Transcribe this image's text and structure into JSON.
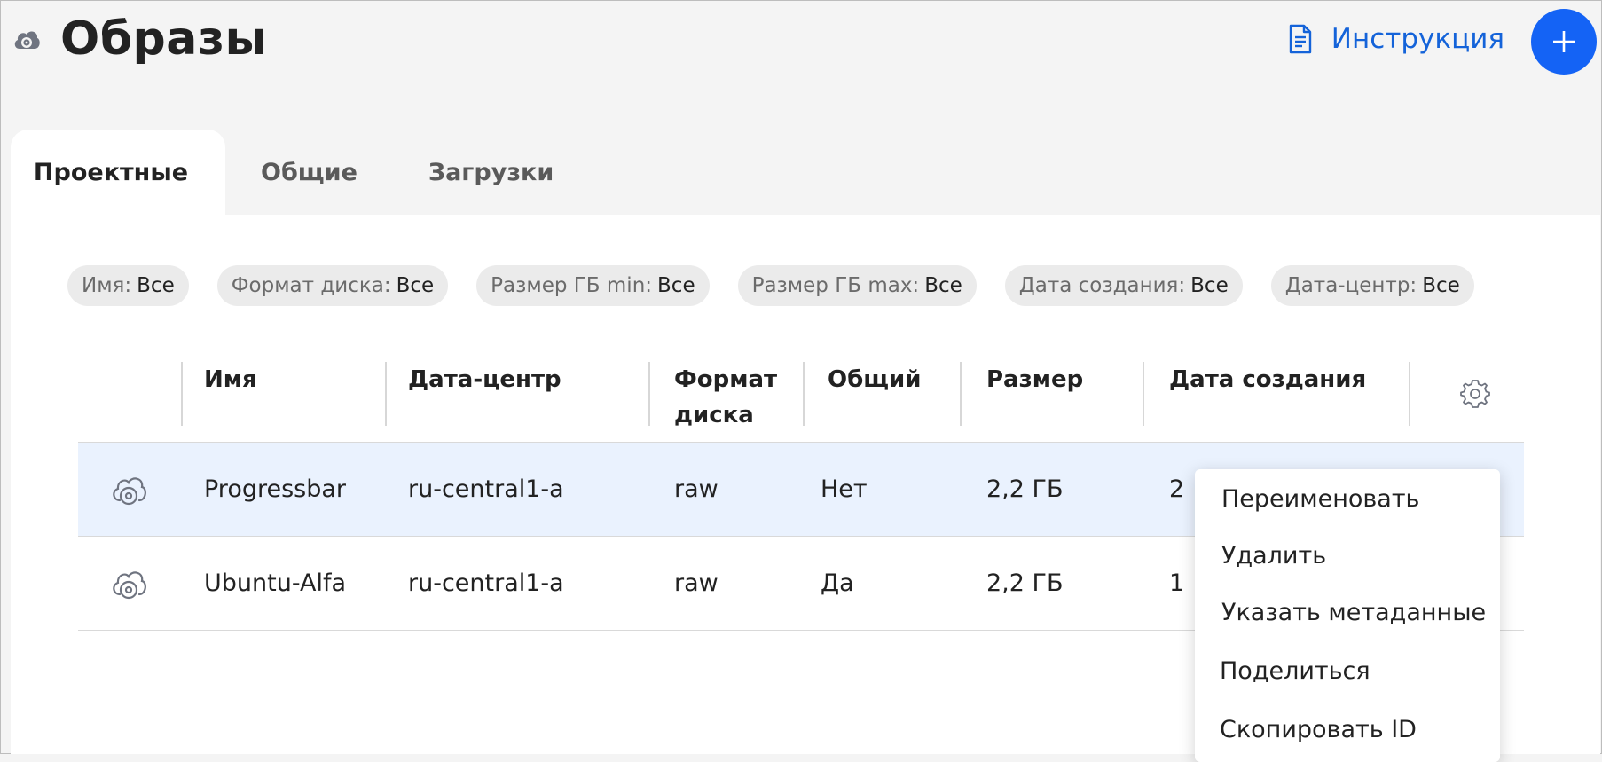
{
  "header": {
    "title": "Образы",
    "icon": "cloud-disk-icon",
    "guide_label": "Инструкция",
    "add_button_icon": "plus-icon"
  },
  "tabs": [
    {
      "label": "Проектные",
      "active": true
    },
    {
      "label": "Общие",
      "active": false
    },
    {
      "label": "Загрузки",
      "active": false
    }
  ],
  "filters": [
    {
      "key": "Имя:",
      "value": "Все"
    },
    {
      "key": "Формат диска:",
      "value": "Все"
    },
    {
      "key": "Размер ГБ min:",
      "value": "Все"
    },
    {
      "key": "Размер ГБ max:",
      "value": "Все"
    },
    {
      "key": "Дата создания:",
      "value": "Все"
    },
    {
      "key": "Дата-центр:",
      "value": "Все"
    }
  ],
  "table": {
    "columns": [
      "Имя",
      "Дата-центр",
      "Формат диска",
      "Общий",
      "Размер",
      "Дата создания"
    ],
    "rows": [
      {
        "name": "Progressbar",
        "datacenter": "ru-central1-a",
        "format": "raw",
        "shared": "Нет",
        "size": "2,2 ГБ",
        "date": "2",
        "selected": true
      },
      {
        "name": "Ubuntu-Alfa",
        "datacenter": "ru-central1-a",
        "format": "raw",
        "shared": "Да",
        "size": "2,2 ГБ",
        "date": "1",
        "selected": false
      }
    ]
  },
  "context_menu": {
    "items": [
      "Переименовать",
      "Удалить",
      "Указать метаданные",
      "Поделиться",
      "Скопировать ID"
    ]
  },
  "colors": {
    "accent": "#1463f5",
    "link": "#1463d9",
    "selected_row": "#eaf2fe"
  }
}
